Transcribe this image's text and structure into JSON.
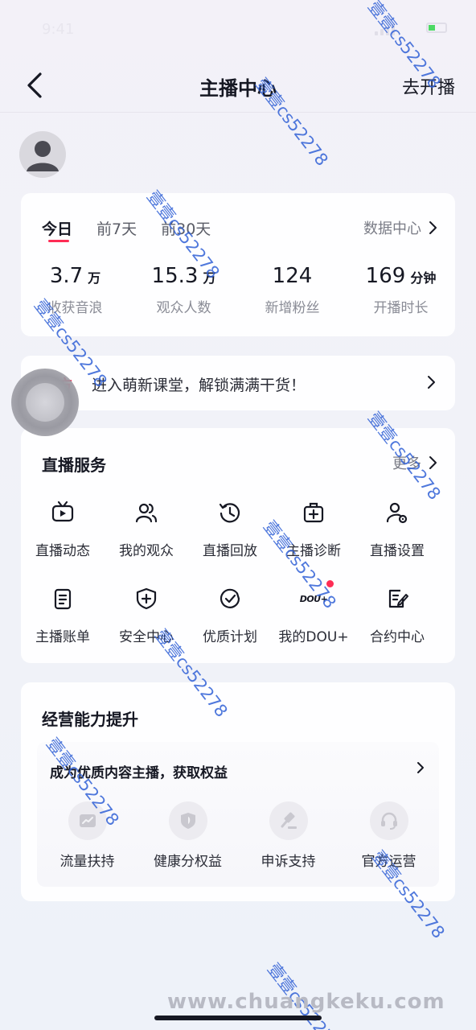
{
  "status_bar": {
    "time": "9:41"
  },
  "header": {
    "title": "主播中心",
    "go_live_label": "去开播"
  },
  "stats": {
    "tabs": [
      {
        "label": "今日",
        "active": true
      },
      {
        "label": "前7天",
        "active": false
      },
      {
        "label": "前30天",
        "active": false
      }
    ],
    "data_center_label": "数据中心",
    "items": [
      {
        "value": "3.7",
        "unit": "万",
        "label": "收获音浪"
      },
      {
        "value": "15.3",
        "unit": "万",
        "label": "观众人数"
      },
      {
        "value": "124",
        "unit": "",
        "label": "新增粉丝"
      },
      {
        "value": "169",
        "unit": "分钟",
        "label": "开播时长"
      }
    ]
  },
  "banner": {
    "tag": "官方",
    "text": "进入萌新课堂，解锁满满干货！"
  },
  "services": {
    "title": "直播服务",
    "more_label": "更多",
    "items": [
      {
        "label": "直播动态",
        "icon": "tv-icon"
      },
      {
        "label": "我的观众",
        "icon": "users-icon"
      },
      {
        "label": "直播回放",
        "icon": "history-icon"
      },
      {
        "label": "主播诊断",
        "icon": "medical-kit-icon"
      },
      {
        "label": "直播设置",
        "icon": "user-settings-icon"
      },
      {
        "label": "主播账单",
        "icon": "bill-icon"
      },
      {
        "label": "安全中心",
        "icon": "shield-plus-icon"
      },
      {
        "label": "优质计划",
        "icon": "check-circle-icon"
      },
      {
        "label": "我的DOU+",
        "icon": "dou-logo-icon",
        "icon_text": "DOU+",
        "badge": true
      },
      {
        "label": "合约中心",
        "icon": "contract-icon"
      }
    ]
  },
  "business": {
    "title": "经营能力提升",
    "subtitle": "成为优质内容主播，获取权益",
    "items": [
      {
        "label": "流量扶持",
        "icon": "trend-icon"
      },
      {
        "label": "健康分权益",
        "icon": "shield-icon"
      },
      {
        "label": "申诉支持",
        "icon": "gavel-icon"
      },
      {
        "label": "官方运营",
        "icon": "headset-icon"
      }
    ]
  },
  "watermarks": {
    "text": "壹壹cs52278",
    "site": "www.chuangkeku.com"
  },
  "colors": {
    "accent": "#fe2c55",
    "text_primary": "#161823",
    "text_secondary": "#8a8c96",
    "watermark": "#3060d6"
  }
}
